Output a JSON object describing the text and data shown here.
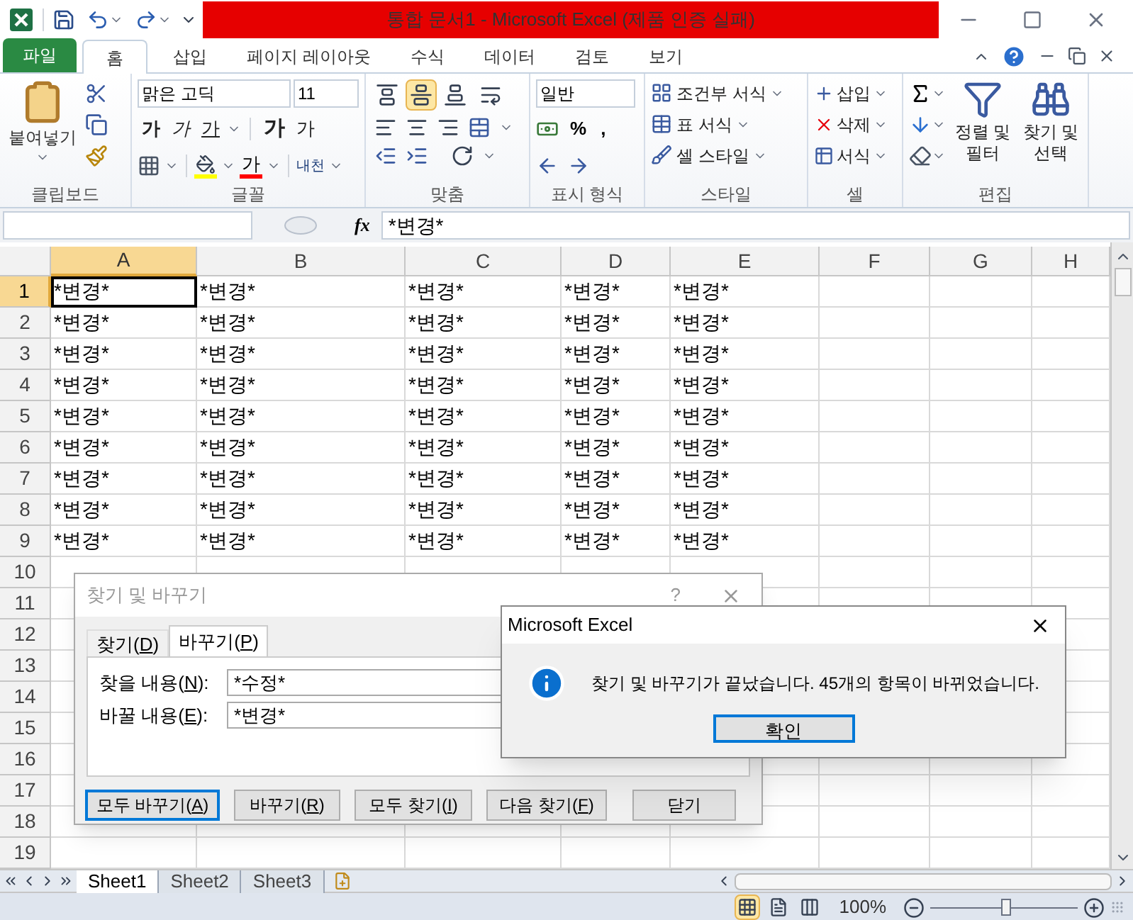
{
  "title_bar": {
    "title": "통합 문서1  -  Microsoft Excel (제품 인증 실패)"
  },
  "ribbon_tabs": [
    {
      "label": "파일",
      "kind": "file",
      "selected": false
    },
    {
      "label": "홈",
      "kind": "tab",
      "selected": true
    },
    {
      "label": "삽입",
      "kind": "tab",
      "selected": false
    },
    {
      "label": "페이지 레이아웃",
      "kind": "tab",
      "selected": false
    },
    {
      "label": "수식",
      "kind": "tab",
      "selected": false
    },
    {
      "label": "데이터",
      "kind": "tab",
      "selected": false
    },
    {
      "label": "검토",
      "kind": "tab",
      "selected": false
    },
    {
      "label": "보기",
      "kind": "tab",
      "selected": false
    }
  ],
  "ribbon": {
    "clipboard": {
      "label": "클립보드",
      "paste": "붙여넣기"
    },
    "font": {
      "label": "글꼴",
      "font_name": "맑은 고딕",
      "font_size": "11",
      "font_color_label": "가",
      "phonetic": "내천",
      "buttons": [
        {
          "kind": "bold",
          "label": "가"
        },
        {
          "kind": "italic",
          "label": "가"
        },
        {
          "kind": "underline",
          "label": "가"
        },
        {
          "kind": "grow",
          "label": "가"
        },
        {
          "kind": "shrink",
          "label": "가"
        }
      ]
    },
    "alignment": {
      "label": "맞춤",
      "vertical": [
        {
          "kind": "top",
          "selected": false
        },
        {
          "kind": "middle",
          "selected": true
        },
        {
          "kind": "bottom",
          "selected": false
        }
      ]
    },
    "number": {
      "label": "표시 형식",
      "format": "일반",
      "symbols": [
        "%",
        ","
      ]
    },
    "styles": {
      "label": "스타일",
      "items": [
        "조건부 서식",
        "표 서식",
        "셀 스타일"
      ]
    },
    "cells": {
      "label": "셀",
      "items": [
        "삽입",
        "삭제",
        "서식"
      ]
    },
    "editing": {
      "label": "편집",
      "items": [
        "정렬 및 필터",
        "찾기 및 선택"
      ]
    }
  },
  "formula_bar": {
    "fx": "fx",
    "value": "*변경*"
  },
  "sheet": {
    "columns": [
      {
        "label": "A",
        "selected": true
      },
      {
        "label": "B",
        "selected": false
      },
      {
        "label": "C",
        "selected": false
      },
      {
        "label": "D",
        "selected": false
      },
      {
        "label": "E",
        "selected": false
      },
      {
        "label": "F",
        "selected": false
      },
      {
        "label": "G",
        "selected": false
      },
      {
        "label": "H",
        "selected": false
      }
    ],
    "rows": [
      {
        "label": "1",
        "selected": true,
        "cells": [
          "*변경*",
          "*변경*",
          "*변경*",
          "*변경*",
          "*변경*"
        ]
      },
      {
        "label": "2",
        "selected": false,
        "cells": [
          "*변경*",
          "*변경*",
          "*변경*",
          "*변경*",
          "*변경*"
        ]
      },
      {
        "label": "3",
        "selected": false,
        "cells": [
          "*변경*",
          "*변경*",
          "*변경*",
          "*변경*",
          "*변경*"
        ]
      },
      {
        "label": "4",
        "selected": false,
        "cells": [
          "*변경*",
          "*변경*",
          "*변경*",
          "*변경*",
          "*변경*"
        ]
      },
      {
        "label": "5",
        "selected": false,
        "cells": [
          "*변경*",
          "*변경*",
          "*변경*",
          "*변경*",
          "*변경*"
        ]
      },
      {
        "label": "6",
        "selected": false,
        "cells": [
          "*변경*",
          "*변경*",
          "*변경*",
          "*변경*",
          "*변경*"
        ]
      },
      {
        "label": "7",
        "selected": false,
        "cells": [
          "*변경*",
          "*변경*",
          "*변경*",
          "*변경*",
          "*변경*"
        ]
      },
      {
        "label": "8",
        "selected": false,
        "cells": [
          "*변경*",
          "*변경*",
          "*변경*",
          "*변경*",
          "*변경*"
        ]
      },
      {
        "label": "9",
        "selected": false,
        "cells": [
          "*변경*",
          "*변경*",
          "*변경*",
          "*변경*",
          "*변경*"
        ]
      },
      {
        "label": "10",
        "selected": false
      },
      {
        "label": "11",
        "selected": false
      },
      {
        "label": "12",
        "selected": false
      },
      {
        "label": "13",
        "selected": false
      },
      {
        "label": "14",
        "selected": false
      },
      {
        "label": "15",
        "selected": false
      },
      {
        "label": "16",
        "selected": false
      },
      {
        "label": "17",
        "selected": false
      },
      {
        "label": "18",
        "selected": false
      },
      {
        "label": "19",
        "selected": false
      }
    ]
  },
  "sheet_tabs": [
    {
      "label": "Sheet1",
      "selected": true
    },
    {
      "label": "Sheet2",
      "selected": false
    },
    {
      "label": "Sheet3",
      "selected": false
    }
  ],
  "status_bar": {
    "zoom": "100%",
    "zoom_slider": {
      "level": 0.52
    },
    "views": [
      {
        "kind": "normal",
        "selected": true
      },
      {
        "kind": "page_layout",
        "selected": false
      },
      {
        "kind": "page_break",
        "selected": false
      }
    ]
  },
  "find_dialog": {
    "title": "찾기 및 바꾸기",
    "help": "?",
    "tabs": [
      {
        "label": "찾기(",
        "hotkey": "D",
        "suffix": ")",
        "selected": false
      },
      {
        "label": "바꾸기(",
        "hotkey": "P",
        "suffix": ")",
        "selected": true
      }
    ],
    "fields": [
      {
        "label": "찾을 내용(",
        "hotkey": "N",
        "suffix": "):",
        "value": "*수정*"
      },
      {
        "label": "바꿀 내용(",
        "hotkey": "E",
        "suffix": "):",
        "value": "*변경*"
      }
    ],
    "buttons": [
      {
        "label": "모두 바꾸기(",
        "hotkey": "A",
        "suffix": ")",
        "default": true
      },
      {
        "label": "바꾸기(",
        "hotkey": "R",
        "suffix": ")",
        "default": false
      },
      {
        "label": "모두 찾기(",
        "hotkey": "I",
        "suffix": ")",
        "default": false
      },
      {
        "label": "다음 찾기(",
        "hotkey": "F",
        "suffix": ")",
        "default": false
      },
      {
        "label": "닫기",
        "default": false
      }
    ]
  },
  "message_box": {
    "title": "Microsoft Excel",
    "message": "찾기 및 바꾸기가 끝났습니다. 45개의 항목이 바뀌었습니다.",
    "button": "확인"
  }
}
